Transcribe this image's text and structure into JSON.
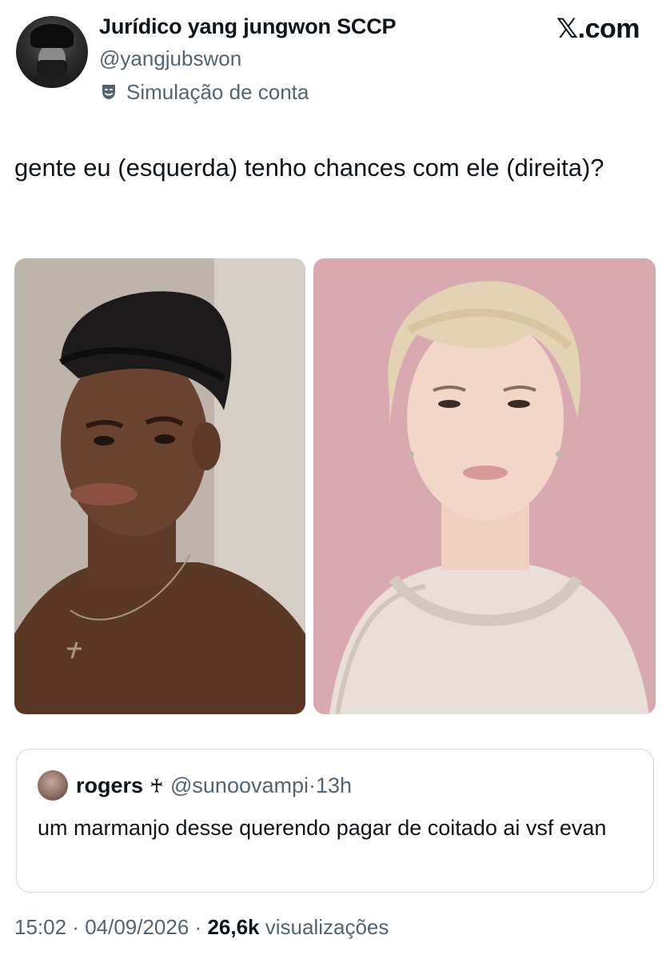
{
  "author": {
    "name": "Jurídico yang jungwon SCCP",
    "handle": "@yangjubswon",
    "label": "Simulação de conta",
    "label_icon": "theater-mask-icon"
  },
  "site_logo": "𝕏.com",
  "tweet": {
    "text": "gente eu (esquerda) tenho chances com ele (direita)?"
  },
  "photos": [
    {
      "label": "left-photo",
      "dominant_color": "#b8b0a6"
    },
    {
      "label": "right-photo",
      "dominant_color": "#d8a6ae"
    }
  ],
  "quoted": {
    "name": "rogers",
    "name_symbol": "♰",
    "handle": "@sunoovampi",
    "separator": "·",
    "time": "13h",
    "text": "um marmanjo desse querendo pagar de coitado ai vsf evan"
  },
  "meta": {
    "time": "15:02",
    "sep1": " · ",
    "date": "04/09/2026",
    "sep2": " · ",
    "views_count": "26,6k",
    "views_label": " visualizações"
  },
  "colors": {
    "text_primary": "#0f1419",
    "text_secondary": "#536471",
    "border": "#cfd9de"
  }
}
